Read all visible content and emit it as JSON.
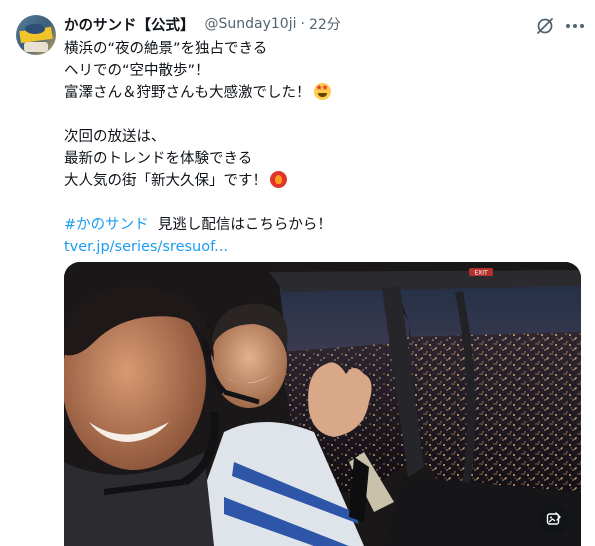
{
  "tweet": {
    "author_name": "かのサンド【公式】",
    "handle": "@Sunday10ji",
    "separator": "·",
    "time": "22分",
    "lines": [
      "横浜の“夜の絶景”を独占できる",
      "ヘリでの“空中散歩”！",
      "富澤さん＆狩野さんも大感激でした！"
    ],
    "lines2": [
      "次回の放送は、",
      "最新のトレンドを体験できる",
      "大人気の街「新大久保」です！"
    ],
    "hashtag": "#かのサンド",
    "after_hashtag": "見逃し配信はこちらから！",
    "link": "tver.jp/series/sresuof..."
  },
  "icons": {
    "grok": "grok-icon",
    "more": "more-icon",
    "emoji1": "star-struck-emoji",
    "emoji2": "heart-on-fire-emoji",
    "media_action": "alt-edit-icon"
  },
  "colors": {
    "link": "#1d9bf0",
    "secondary_text": "#536471",
    "primary_text": "#0f1419"
  },
  "media": {
    "description_label": "",
    "overlay_text": "EXIT"
  }
}
